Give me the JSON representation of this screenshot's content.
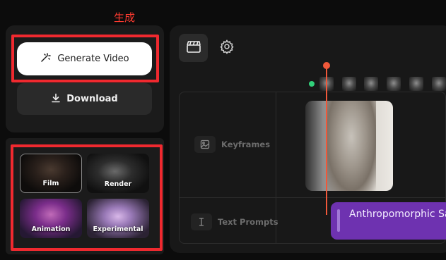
{
  "annotation": {
    "label": "生成"
  },
  "actions": {
    "generate_label": "Generate Video",
    "download_label": "Download"
  },
  "styles": [
    {
      "label": "Film"
    },
    {
      "label": "Render"
    },
    {
      "label": "Animation"
    },
    {
      "label": "Experimental"
    }
  ],
  "timeline": {
    "tracks": [
      {
        "label": "Keyframes",
        "icon": "image-icon"
      },
      {
        "label": "Text Prompts",
        "icon": "text-cursor-icon"
      }
    ],
    "prompt_clip_text": "Anthropomorphic Sar"
  },
  "colors": {
    "highlight_box": "#f0292f",
    "playhead": "#f0583a",
    "prompt_clip": "#6e32b0",
    "status_dot": "#31d07a"
  }
}
